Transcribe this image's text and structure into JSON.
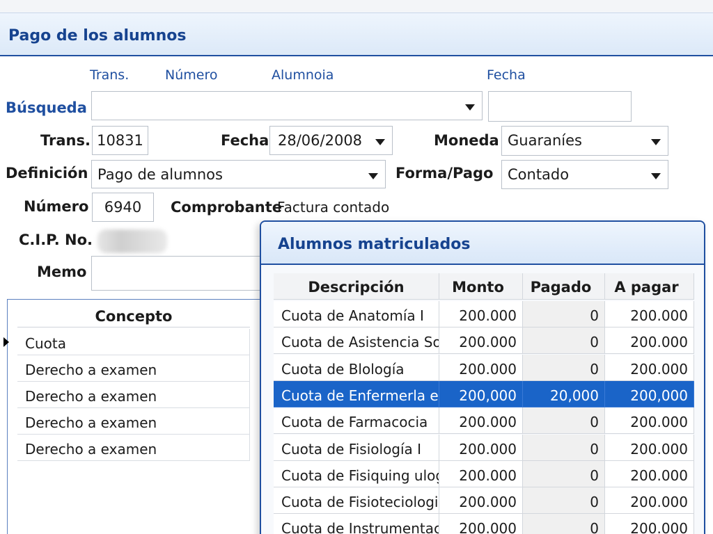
{
  "window": {
    "title": "Pago de los alumnos"
  },
  "search_headers": [
    "Trans.",
    "Número",
    "Alumnoia",
    "Fecha"
  ],
  "labels": {
    "busqueda": "Búsqueda",
    "trans": "Trans.",
    "fecha": "Fecha",
    "moneda": "Moneda",
    "definicion": "Definición",
    "forma_pago": "Forma/Pago",
    "numero": "Número",
    "comprobante": "Comprobante",
    "cip": "C.I.P. No.",
    "memo": "Memo"
  },
  "fields": {
    "busqueda": "",
    "busqueda_fecha": "",
    "trans": "10831",
    "fecha": "28/06/2008",
    "moneda": "Guaraníes",
    "definicion": "Pago de alumnos",
    "forma_pago": "Contado",
    "numero": "6940",
    "comprobante": "Factura contado",
    "memo": ""
  },
  "concepto": {
    "header": "Concepto",
    "rows": [
      "Cuota",
      "Derecho a examen",
      "Derecho a examen",
      "Derecho a examen",
      "Derecho a examen"
    ]
  },
  "popup": {
    "title": "Alumnos matriculados",
    "columns": [
      "Descripción",
      "Monto",
      "Pagado",
      "A pagar"
    ],
    "rows": [
      [
        "Cuota de Anatomía I",
        "200.000",
        "0",
        "200.000"
      ],
      [
        "Cuota de Asistencia Social",
        "200.000",
        "0",
        "200.000"
      ],
      [
        "Cuota de Blología",
        "200.000",
        "0",
        "200.000"
      ],
      [
        "Cuota de Enfermerla en",
        "200,000",
        "20,000",
        "200,000"
      ],
      [
        "Cuota de Farmacocia",
        "200.000",
        "0",
        "200.000"
      ],
      [
        "Cuota de Fisiología I",
        "200.000",
        "0",
        "200.000"
      ],
      [
        "Cuota de Fisiquing ulogia",
        "200.000",
        "0",
        "200.000"
      ],
      [
        "Cuota de Fisioteciologia",
        "200.000",
        "0",
        "200.000"
      ],
      [
        "Cuota de Instrumentación",
        "200.000",
        "0",
        "200.000"
      ]
    ]
  },
  "colors": {
    "accent": "#1f4fa0",
    "selection": "#1a64c8"
  }
}
